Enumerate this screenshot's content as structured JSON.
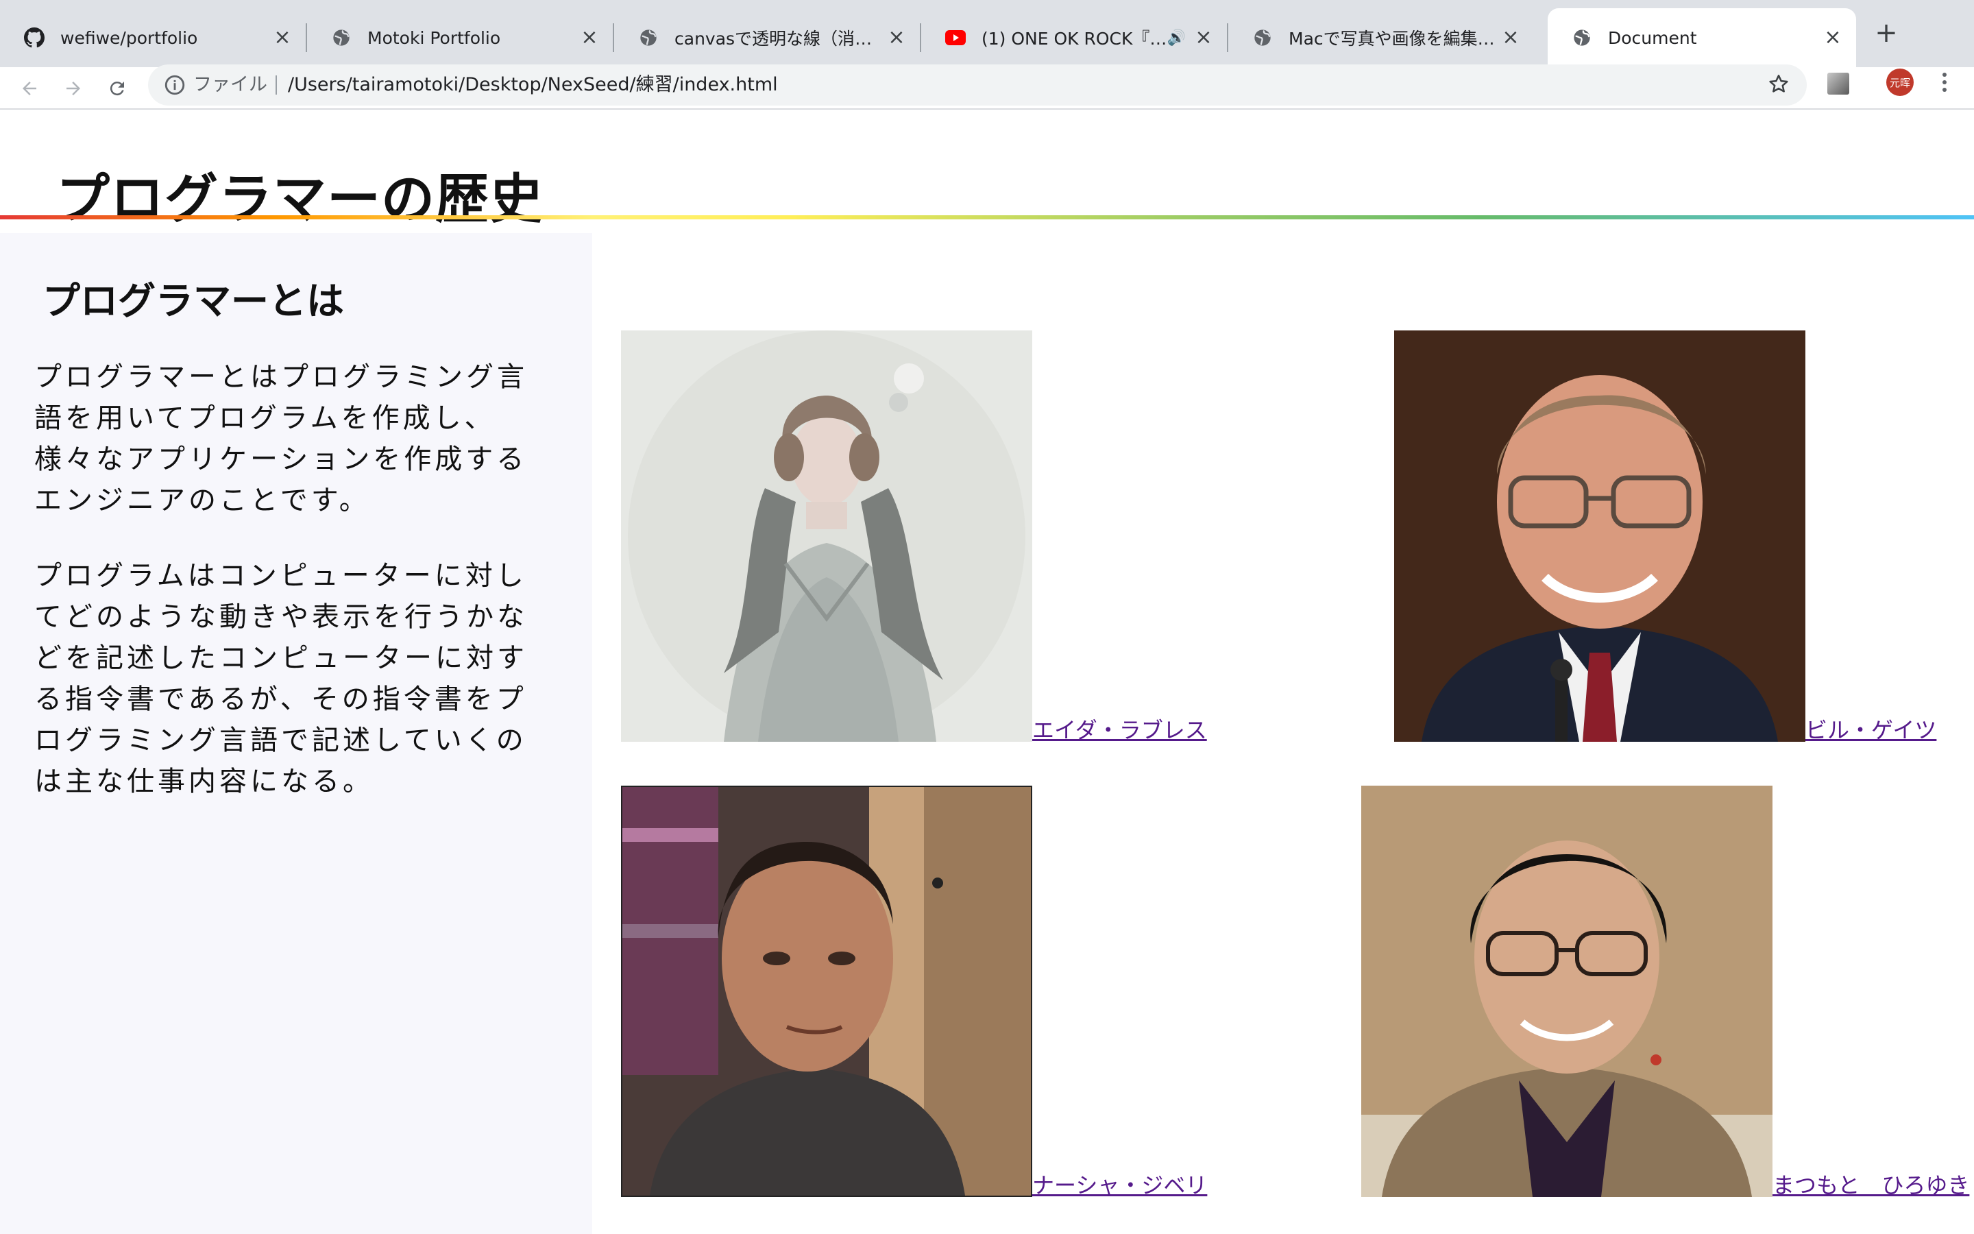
{
  "browser": {
    "tabs": [
      {
        "title": "wefiwe/portfolio",
        "icon": "github-icon"
      },
      {
        "title": "Motoki Portfolio",
        "icon": "globe-icon"
      },
      {
        "title": "canvasで透明な線（消しゴム）",
        "icon": "globe-icon"
      },
      {
        "title": "(1) ONE OK ROCK『キミシダイ列車』",
        "icon": "youtube-icon"
      },
      {
        "title": "Macで写真や画像を編集でサイズ",
        "icon": "globe-icon"
      },
      {
        "title": "Document",
        "icon": "globe-icon"
      }
    ],
    "omnibox": {
      "scheme_label": "ファイル",
      "url": "/Users/tairamotoki/Desktop/NexSeed/練習/index.html"
    },
    "avatar_text": "元晖"
  },
  "page": {
    "title": "プログラマーの歴史",
    "sidebar": {
      "heading": "プログラマーとは",
      "paragraphs": [
        "プログラマーとはプログラミング言語を用いてプログラムを作成し、様々なアプリケーションを作成するエンジニアのことです。",
        "プログラムはコンピューターに対してどのような動きや表示を行うかなどを記述したコンピューターに対する指令書であるが、その指令書をプログラミング言語で記述していくのは主な仕事内容になる。"
      ]
    },
    "people": [
      {
        "name": "エイダ・ラブレス",
        "photo": "engraving-portrait"
      },
      {
        "name": "ビル・ゲイツ",
        "photo": "photo-portrait"
      },
      {
        "name": "ナーシャ・ジベリ",
        "photo": "photo-portrait"
      },
      {
        "name": "まつもと　ひろゆき",
        "photo": "photo-portrait"
      }
    ]
  },
  "colors": {
    "tabstrip_bg": "#dee1e6",
    "link_visited": "#551a8b",
    "sidebar_bg": "#f7f7fc",
    "rainbow": [
      "#e53935",
      "#ff9800",
      "#ffee58",
      "#66bb6a",
      "#4fc3f7"
    ]
  }
}
